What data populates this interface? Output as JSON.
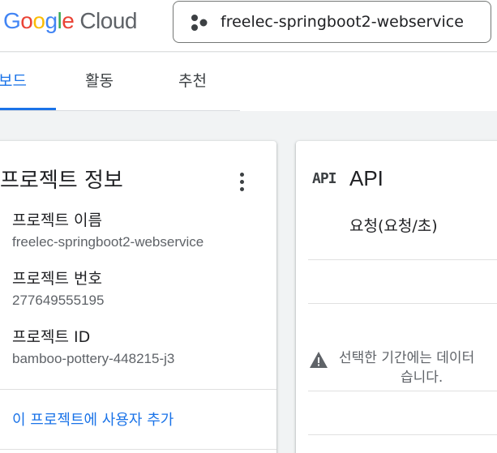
{
  "header": {
    "logo": {
      "google_letters": [
        {
          "char": "G",
          "color": "#4285F4"
        },
        {
          "char": "o",
          "color": "#EA4335"
        },
        {
          "char": "o",
          "color": "#FBBC05"
        },
        {
          "char": "g",
          "color": "#4285F4"
        },
        {
          "char": "l",
          "color": "#34A853"
        },
        {
          "char": "e",
          "color": "#EA4335"
        }
      ],
      "cloud_word": "Cloud"
    },
    "project_picker": {
      "icon": "project-hexagon-dots-icon",
      "project_name": "freelec-springboot2-webservice"
    }
  },
  "tabs": [
    {
      "label": "보드",
      "active": true
    },
    {
      "label": "활동",
      "active": false
    },
    {
      "label": "추천",
      "active": false
    }
  ],
  "project_info_card": {
    "title": "프로젝트 정보",
    "menu_icon": "more-vert-icon",
    "fields": [
      {
        "label": "프로젝트 이름",
        "value": "freelec-springboot2-webservice"
      },
      {
        "label": "프로젝트 번호",
        "value": "277649555195"
      },
      {
        "label": "프로젝트 ID",
        "value": "bamboo-pottery-448215-j3"
      }
    ],
    "add_user_link": "이 프로젝트에 사용자 추가"
  },
  "api_card": {
    "icon_text": "API",
    "title": "API",
    "metric_label": "요청(요청/초)",
    "warning_icon": "warning-triangle-icon",
    "no_data_message_line1": "선택한 기간에는 데이터",
    "no_data_message_line2": "습니다."
  },
  "colors": {
    "accent": "#1a73e8",
    "page_background": "#f1f3f4",
    "secondary_text": "#5f6368"
  }
}
